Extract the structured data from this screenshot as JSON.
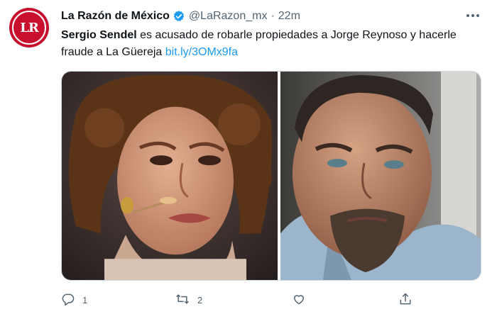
{
  "tweet": {
    "avatar_text": "LR",
    "name": "La Razón de México",
    "handle": "@LaRazon_mx",
    "separator": "·",
    "time": "22m",
    "text_bold": "Sergio Sendel",
    "text_body": " es acusado de robarle propiedades a Jorge Reynoso y hacerle fraude a La Güereja ",
    "link": "bit.ly/3OMx9fa"
  },
  "actions": {
    "reply_count": "1",
    "retweet_count": "2"
  },
  "icons": {
    "verified": "verified-badge-icon",
    "more": "more-horizontal-icon",
    "reply": "reply-icon",
    "retweet": "retweet-icon",
    "like": "like-icon",
    "share": "share-icon"
  },
  "colors": {
    "brand_red": "#c8102e",
    "link_blue": "#1d9bf0",
    "secondary_text": "#536471"
  }
}
